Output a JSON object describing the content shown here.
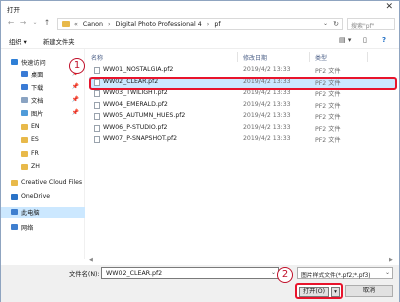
{
  "window": {
    "title": "打开",
    "close_glyph": "✕"
  },
  "nav": {
    "back": "←",
    "forward": "→",
    "dropdown": "⌄",
    "up": "↑"
  },
  "address": {
    "crumbs": [
      "Canon",
      "Digital Photo Professional 4",
      "pf"
    ],
    "lead_sep": "«",
    "sep": "›",
    "dd": "⌄",
    "refresh": "↻"
  },
  "search": {
    "placeholder": "搜索\"pf\"",
    "icon": "🔍"
  },
  "toolbar": {
    "organize": "组织 ▾",
    "new_folder": "新建文件夹",
    "view": "▤ ▾",
    "pane": "▯",
    "help": "?"
  },
  "sidebar": {
    "items": [
      {
        "label": "快速访问",
        "icon": "star-icon",
        "color": "#2f7fd6",
        "indent": 10
      },
      {
        "label": "桌面",
        "icon": "desktop-icon",
        "color": "#3a7bd5",
        "indent": 20,
        "pinned": true
      },
      {
        "label": "下载",
        "icon": "download-icon",
        "color": "#3a7bd5",
        "indent": 20,
        "pinned": true
      },
      {
        "label": "文档",
        "icon": "document-icon",
        "color": "#8aa3c2",
        "indent": 20,
        "pinned": true
      },
      {
        "label": "图片",
        "icon": "picture-icon",
        "color": "#4f9bd9",
        "indent": 20,
        "pinned": true
      },
      {
        "label": "EN",
        "icon": "folder-icon",
        "color": "#e8b94a",
        "indent": 20
      },
      {
        "label": "ES",
        "icon": "folder-icon",
        "color": "#e8b94a",
        "indent": 20
      },
      {
        "label": "FR",
        "icon": "folder-icon",
        "color": "#e8b94a",
        "indent": 20
      },
      {
        "label": "ZH",
        "icon": "folder-icon",
        "color": "#e8b94a",
        "indent": 20
      },
      {
        "label": "Creative Cloud Files",
        "icon": "creative-cloud-icon",
        "color": "#e8b94a",
        "indent": 10
      },
      {
        "label": "OneDrive",
        "icon": "onedrive-icon",
        "color": "#2a73c7",
        "indent": 10
      },
      {
        "label": "此电脑",
        "icon": "this-pc-icon",
        "color": "#3f7fcf",
        "indent": 10,
        "selected": true
      },
      {
        "label": "网络",
        "icon": "network-icon",
        "color": "#3f7fcf",
        "indent": 10
      }
    ],
    "pin_glyph": "📌"
  },
  "columns": {
    "name": "名称",
    "date": "修改日期",
    "type": "类型"
  },
  "files": [
    {
      "name": "WW01_NOSTALGIA.pf2",
      "date": "2019/4/2 13:33",
      "type": "PF2 文件"
    },
    {
      "name": "WW02_CLEAR.pf2",
      "date": "2019/4/2 13:33",
      "type": "PF2 文件",
      "selected": true
    },
    {
      "name": "WW03_TWILIGHT.pf2",
      "date": "2019/4/2 13:33",
      "type": "PF2 文件"
    },
    {
      "name": "WW04_EMERALD.pf2",
      "date": "2019/4/2 13:33",
      "type": "PF2 文件"
    },
    {
      "name": "WW05_AUTUMN_HUES.pf2",
      "date": "2019/4/2 13:33",
      "type": "PF2 文件"
    },
    {
      "name": "WW06_P-STUDIO.pf2",
      "date": "2019/4/2 13:33",
      "type": "PF2 文件"
    },
    {
      "name": "WW07_P-SNAPSHOT.pf2",
      "date": "2019/4/2 13:33",
      "type": "PF2 文件"
    }
  ],
  "scroll": {
    "left": "◀",
    "right": "▶"
  },
  "bottom": {
    "filename_label": "文件名(N):",
    "filename_value": "WW02_CLEAR.pf2",
    "filter": "图片样式文件(*.pf2;*.pf3)",
    "dd": "⌄",
    "open_label": "打开(O)",
    "open_split": "▾",
    "cancel_label": "取消"
  },
  "callouts": {
    "one": "1",
    "two": "2"
  }
}
